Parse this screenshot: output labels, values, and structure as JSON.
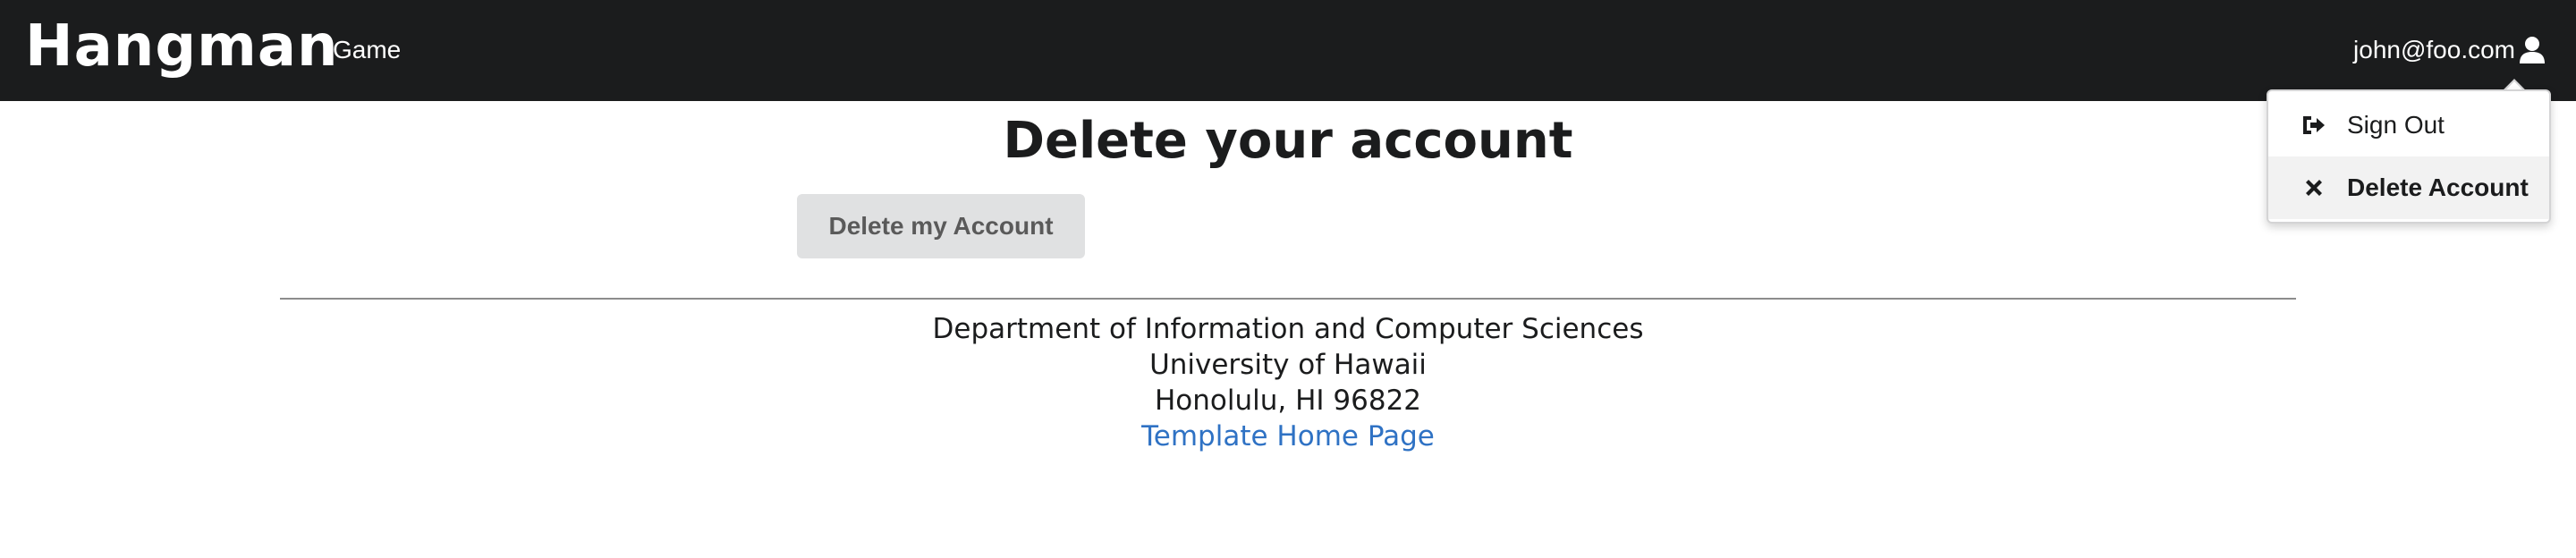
{
  "navbar": {
    "brand": "Hangman",
    "game_link": "Game",
    "user_email": "john@foo.com",
    "user_icon": "user-icon"
  },
  "dropdown": {
    "items": [
      {
        "label": "Sign Out",
        "icon": "sign-out-icon"
      },
      {
        "label": "Delete Account",
        "icon": "close-icon",
        "active": true
      }
    ]
  },
  "main": {
    "title": "Delete your account",
    "delete_button": "Delete my Account"
  },
  "footer": {
    "line1": "Department of Information and Computer Sciences",
    "line2": "University of Hawaii",
    "line3": "Honolulu, HI 96822",
    "link": "Template Home Page"
  },
  "colors": {
    "navbar_bg": "#1b1c1d",
    "button_bg": "#e0e1e2",
    "link": "#2f72c4"
  }
}
